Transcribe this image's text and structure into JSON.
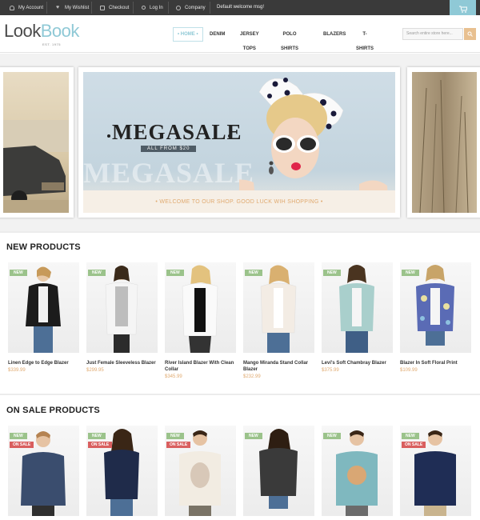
{
  "topbar": {
    "my_account": "My Account",
    "my_wishlist": "My Wishlist",
    "checkout": "Checkout",
    "log_in": "Log In",
    "company": "Company",
    "welcome": "Default welcome msg!"
  },
  "header": {
    "logo_part1": "Look",
    "logo_part2": "Book",
    "logo_tagline": "EST. 1975",
    "search_placeholder": "Search entire store here...",
    "nav": [
      "HOME",
      "DENIM",
      "JERSEY TOPS",
      "POLO SHIRTS",
      "BLAZERS",
      "T-SHIRTS & VESTS"
    ]
  },
  "slider": {
    "title": "MEGASALE",
    "subtitle": "ALL FROM $20",
    "ghost_text": "MEGASALE",
    "banner": "• WELCOME TO OUR SHOP. GOOD LUCK WIH SHOPPING •"
  },
  "new_products": {
    "title": "NEW PRODUCTS",
    "badge": "NEW",
    "items": [
      {
        "name": "Linen Edge to Edge Blazer",
        "price": "$339.99"
      },
      {
        "name": "Just Female Sleeveless Blazer",
        "price": "$299.95"
      },
      {
        "name": "River Island Blazer With Clean Collar",
        "price": "$345.99"
      },
      {
        "name": "Mango Miranda Stand Collar Blazer",
        "price": "$232.99"
      },
      {
        "name": "Levi's Soft Chambray Blazer",
        "price": "$375.99"
      },
      {
        "name": "Blazer In Soft Floral Print",
        "price": "$109.99"
      }
    ]
  },
  "sale_products": {
    "title": "ON SALE PRODUCTS",
    "badge_new": "NEW",
    "badge_sale": "ON SALE"
  },
  "colors": {
    "accent": "#8fc9d6",
    "price": "#e0aa70",
    "badge_new": "#9bc38b",
    "badge_sale": "#d95f5f",
    "topbar": "#3a3a3a"
  }
}
